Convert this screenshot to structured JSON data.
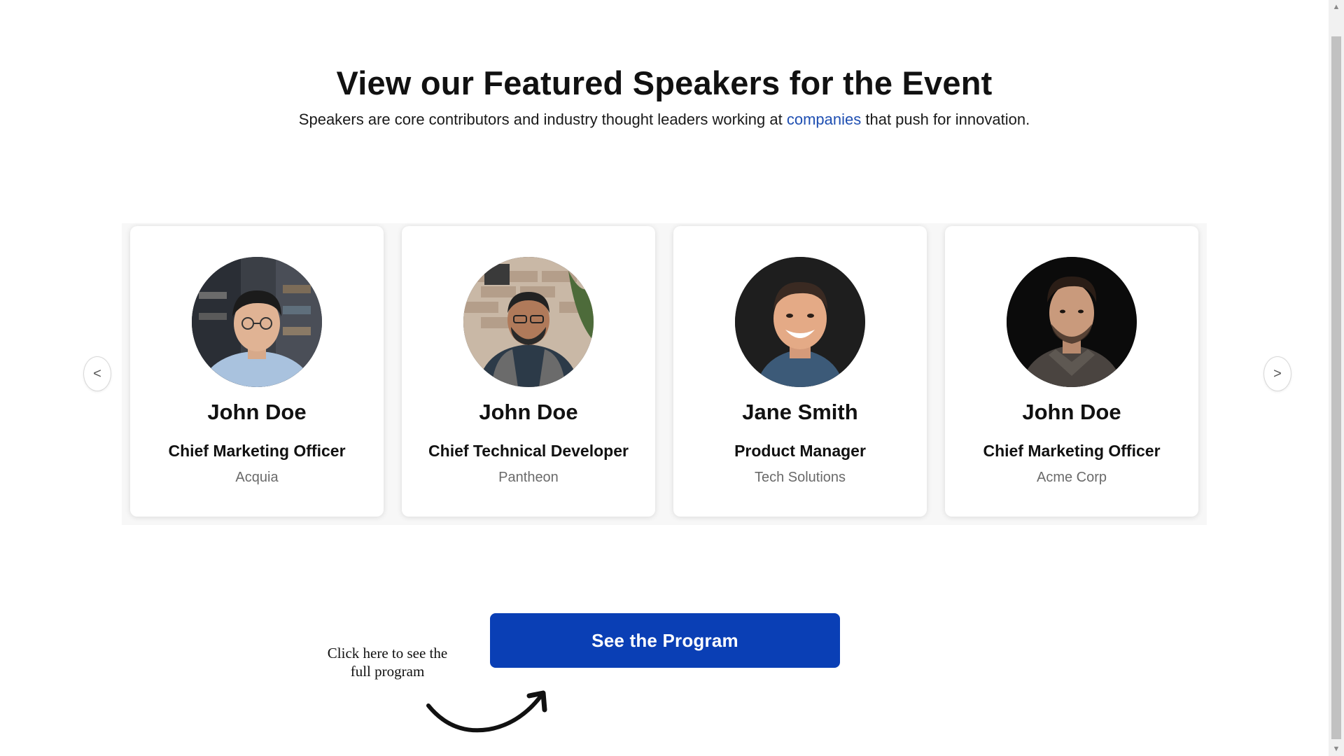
{
  "header": {
    "title": "View our Featured Speakers for the Event",
    "subtitle_before": "Speakers are core contributors and industry thought leaders working at ",
    "subtitle_link": "companies",
    "subtitle_after": " that push for innovation."
  },
  "carousel": {
    "prev_label": "<",
    "next_label": ">",
    "speakers": [
      {
        "name": "John Doe",
        "role": "Chief Marketing Officer",
        "company": "Acquia"
      },
      {
        "name": "John Doe",
        "role": "Chief Technical Developer",
        "company": "Pantheon"
      },
      {
        "name": "Jane Smith",
        "role": "Product Manager",
        "company": "Tech Solutions"
      },
      {
        "name": "John Doe",
        "role": "Chief Marketing Officer",
        "company": "Acme Corp"
      }
    ]
  },
  "cta": {
    "button_label": "See the Program",
    "hint_line1": "Click here to see the",
    "hint_line2": "full program"
  },
  "icons": {
    "scroll_up": "triangle-up-icon",
    "scroll_down": "triangle-down-icon",
    "arrow": "curved-arrow-icon"
  },
  "colors": {
    "primary": "#0a3fb5",
    "link": "#1f4fb2",
    "muted_text": "#6a6a6a"
  }
}
